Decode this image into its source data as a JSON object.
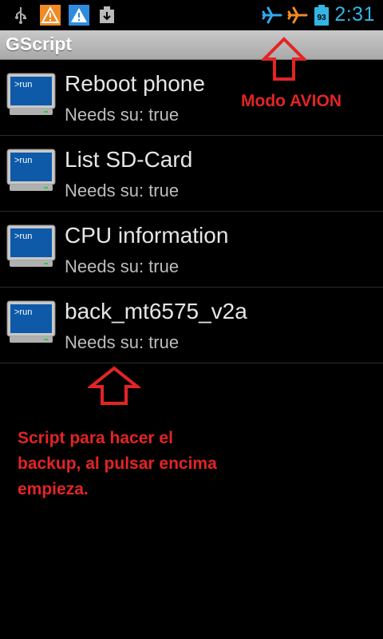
{
  "status_bar": {
    "time": "2:31",
    "battery_level": "93",
    "icons": [
      "usb-icon",
      "warning-icon",
      "alert-triangle-icon",
      "download-icon",
      "airplane-icon",
      "airplane-orange-icon",
      "battery-icon"
    ],
    "colors": {
      "time": "#33b5e5",
      "warning": "#f08a24",
      "alert": "#2f8be0",
      "airplane_blue": "#2fa9ea",
      "airplane_orange": "#f08a24"
    }
  },
  "app": {
    "title": "GScript"
  },
  "scripts": [
    {
      "name": "Reboot phone",
      "needs_su": "Needs su: true",
      "icon_text": ">run"
    },
    {
      "name": "List SD-Card",
      "needs_su": "Needs su: true",
      "icon_text": ">run"
    },
    {
      "name": "CPU information",
      "needs_su": "Needs su: true",
      "icon_text": ">run"
    },
    {
      "name": "back_mt6575_v2a",
      "needs_su": "Needs su: true",
      "icon_text": ">run"
    }
  ],
  "annotations": {
    "airplane_note": "Modo AVION",
    "backup_note_lines": [
      "Script para hacer el",
      "backup, al pulsar encima",
      "empieza."
    ],
    "color": "#e32424"
  }
}
